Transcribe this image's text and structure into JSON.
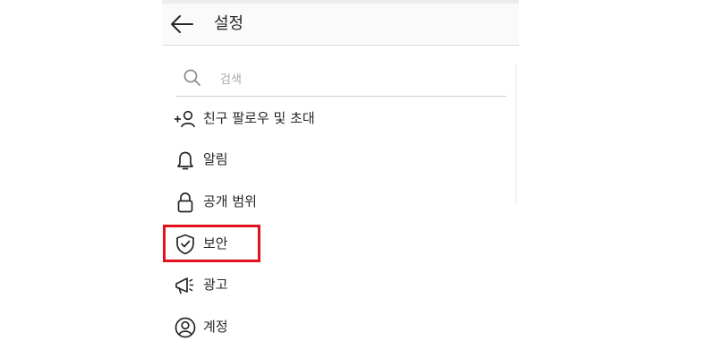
{
  "header": {
    "title": "설정"
  },
  "search": {
    "placeholder": "검색"
  },
  "menu": [
    {
      "label": "친구 팔로우 및 초대",
      "icon": "add-person-icon"
    },
    {
      "label": "알림",
      "icon": "bell-icon"
    },
    {
      "label": "공개 범위",
      "icon": "lock-icon"
    },
    {
      "label": "보안",
      "icon": "shield-check-icon"
    },
    {
      "label": "광고",
      "icon": "megaphone-icon"
    },
    {
      "label": "계정",
      "icon": "account-circle-icon"
    }
  ],
  "colors": {
    "highlight": "#e0121c",
    "text": "#262626",
    "placeholder": "#a8a8a8"
  }
}
